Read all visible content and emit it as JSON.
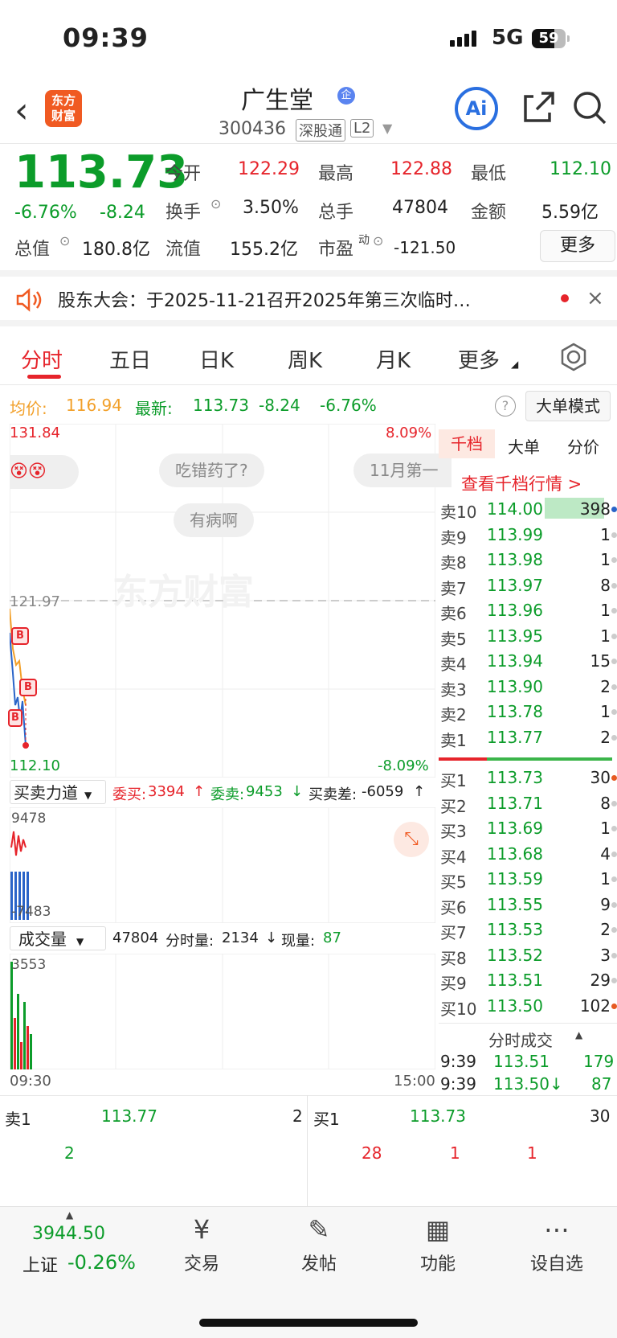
{
  "status": {
    "time": "09:39",
    "network": "5G",
    "battery": "59"
  },
  "header": {
    "back_icon": "chevron-left-icon",
    "logo_text": "东方财富",
    "name": "广生堂",
    "badge": "企",
    "code": "300436",
    "tag1": "深股通",
    "tag2": "L2",
    "ai_label": "Ai"
  },
  "quote": {
    "price": "113.73",
    "change_pct": "-6.76%",
    "change": "-8.24",
    "open_label": "今开",
    "open": "122.29",
    "high_label": "最高",
    "high": "122.88",
    "low_label": "最低",
    "low": "112.10",
    "turnover_label": "换手",
    "turnover": "3.50%",
    "volume_label": "总手",
    "volume": "47804",
    "amount_label": "金额",
    "amount": "5.59亿",
    "mktcap_label": "总值",
    "mktcap": "180.8亿",
    "float_label": "流值",
    "float": "155.2亿",
    "pe_label": "市盈",
    "pe_sup": "动",
    "pe": "-121.50",
    "more_label": "更多"
  },
  "notice": {
    "text": "股东大会：于2025-11-21召开2025年第三次临时…"
  },
  "tabs": [
    "分时",
    "五日",
    "日K",
    "周K",
    "月K",
    "更多"
  ],
  "chart_header": {
    "avg_label": "均价:",
    "avg": "116.94",
    "latest_label": "最新:",
    "latest": "113.73",
    "chg": "-8.24",
    "chg_pct": "-6.76%",
    "mode_btn": "大单模式"
  },
  "chart": {
    "ymax": "131.84",
    "ymax_pct": "8.09%",
    "ymin": "112.10",
    "ymin_pct": "-8.09%",
    "ref": "121.97",
    "watermark": "东方财富",
    "bubble1": "吃错药了?",
    "bubble2": "有病啊",
    "bubble3": "11月第一",
    "start_time": "09:30",
    "end_time": "15:00"
  },
  "force": {
    "label": "买卖力道",
    "buy_label": "委买:",
    "buy": "3394",
    "sell_label": "委卖:",
    "sell": "9453",
    "diff_label": "买卖差:",
    "diff": "-6059",
    "top": "9478",
    "bottom": "-7483"
  },
  "volume": {
    "label": "成交量",
    "total": "47804",
    "min_label": "分时量:",
    "min_vol": "2134",
    "now_label": "现量:",
    "now_vol": "87",
    "top": "3553"
  },
  "book_tabs": [
    "千档",
    "大单",
    "分价"
  ],
  "book_link": "查看千档行情 >",
  "asks": [
    {
      "label": "卖10",
      "price": "114.00",
      "vol": "398"
    },
    {
      "label": "卖9",
      "price": "113.99",
      "vol": "1"
    },
    {
      "label": "卖8",
      "price": "113.98",
      "vol": "1"
    },
    {
      "label": "卖7",
      "price": "113.97",
      "vol": "8"
    },
    {
      "label": "卖6",
      "price": "113.96",
      "vol": "1"
    },
    {
      "label": "卖5",
      "price": "113.95",
      "vol": "1"
    },
    {
      "label": "卖4",
      "price": "113.94",
      "vol": "15"
    },
    {
      "label": "卖3",
      "price": "113.90",
      "vol": "2"
    },
    {
      "label": "卖2",
      "price": "113.78",
      "vol": "1"
    },
    {
      "label": "卖1",
      "price": "113.77",
      "vol": "2"
    }
  ],
  "bids": [
    {
      "label": "买1",
      "price": "113.73",
      "vol": "30"
    },
    {
      "label": "买2",
      "price": "113.71",
      "vol": "8"
    },
    {
      "label": "买3",
      "price": "113.69",
      "vol": "1"
    },
    {
      "label": "买4",
      "price": "113.68",
      "vol": "4"
    },
    {
      "label": "买5",
      "price": "113.59",
      "vol": "1"
    },
    {
      "label": "买6",
      "price": "113.55",
      "vol": "9"
    },
    {
      "label": "买7",
      "price": "113.53",
      "vol": "2"
    },
    {
      "label": "买8",
      "price": "113.52",
      "vol": "3"
    },
    {
      "label": "买9",
      "price": "113.51",
      "vol": "29"
    },
    {
      "label": "买10",
      "price": "113.50",
      "vol": "102"
    }
  ],
  "ticks_title": "分时成交",
  "ticks": [
    {
      "time": "9:39",
      "price": "113.51",
      "vol": "179"
    },
    {
      "time": "9:39",
      "price": "113.50↓",
      "vol": "87"
    }
  ],
  "level2": {
    "sell_label": "卖1",
    "sell_price": "113.77",
    "sell_qty": "2",
    "buy_label": "买1",
    "buy_price": "113.73",
    "buy_qty": "30",
    "sell_orders": [
      "2"
    ],
    "buy_orders": [
      "28",
      "1",
      "1"
    ]
  },
  "index": {
    "value": "3944.50",
    "name": "上证",
    "chg": "-0.26%"
  },
  "nav": [
    {
      "label": "交易",
      "icon": "yuan-icon"
    },
    {
      "label": "发帖",
      "icon": "edit-icon"
    },
    {
      "label": "功能",
      "icon": "grid-icon"
    },
    {
      "label": "设自选",
      "icon": "more-icon"
    }
  ]
}
